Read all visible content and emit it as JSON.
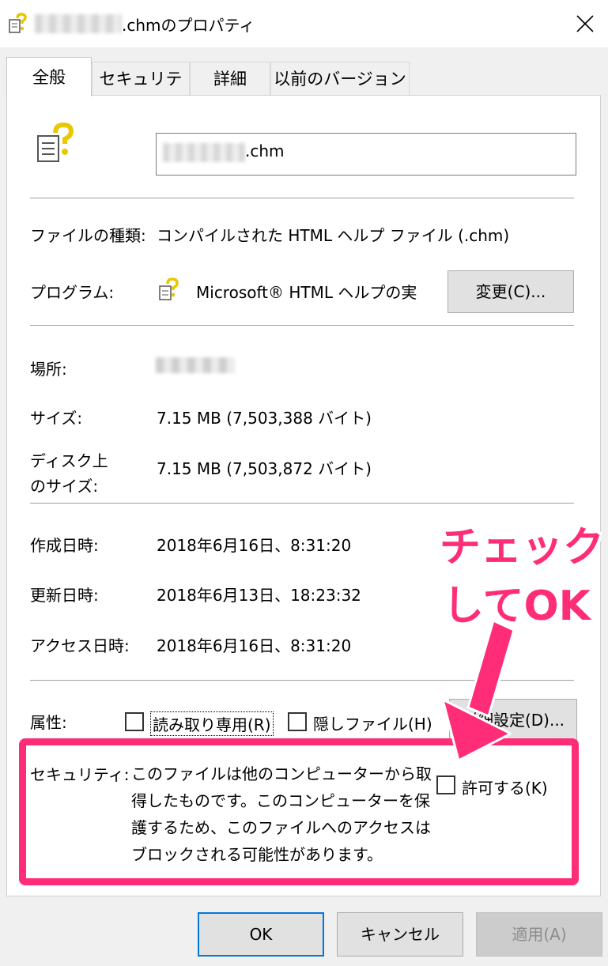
{
  "window": {
    "title": ".chmのプロパティ"
  },
  "tabs": [
    {
      "label": "全般"
    },
    {
      "label": "セキュリティ"
    },
    {
      "label": "詳細"
    },
    {
      "label": "以前のバージョン"
    }
  ],
  "file": {
    "name_suffix": ".chm"
  },
  "fields": {
    "type_label": "ファイルの種類:",
    "type_value": "コンパイルされた HTML ヘルプ ファイル (.chm)",
    "program_label": "プログラム:",
    "program_value": "Microsoft® HTML ヘルプの実",
    "change_button": "変更(C)...",
    "location_label": "場所:",
    "size_label": "サイズ:",
    "size_value": "7.15 MB (7,503,388 バイト)",
    "disk_size_label_line1": "ディスク上",
    "disk_size_label_line2": "のサイズ:",
    "disk_size_value": "7.15 MB (7,503,872 バイト)",
    "created_label": "作成日時:",
    "created_value": "2018年6月16日、8:31:20",
    "modified_label": "更新日時:",
    "modified_value": "2018年6月13日、18:23:32",
    "accessed_label": "アクセス日時:",
    "accessed_value": "2018年6月16日、8:31:20"
  },
  "attributes": {
    "label": "属性:",
    "readonly": "読み取り専用(R)",
    "hidden": "隠しファイル(H)",
    "advanced_button": "詳細設定(D)..."
  },
  "security": {
    "label": "セキュリティ:",
    "description": "このファイルは他のコンピューターから取得したものです。このコンピューターを保護するため、このファイルへのアクセスはブロックされる可能性があります。",
    "allow": "許可する(K)"
  },
  "annotation": {
    "line1": "チェック",
    "line2": "してOK"
  },
  "buttons": {
    "ok": "OK",
    "cancel": "キャンセル",
    "apply": "適用(A)"
  },
  "colors": {
    "annotation": "#ff2d78",
    "focus": "#0078d7"
  }
}
